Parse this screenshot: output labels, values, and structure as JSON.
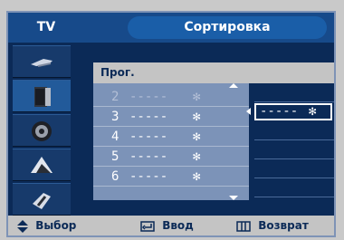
{
  "header": {
    "menu_name": "TV",
    "title": "Сортировка"
  },
  "sidebar": {
    "items": [
      {
        "icon": "antenna-icon"
      },
      {
        "icon": "tv-set-icon"
      },
      {
        "icon": "speaker-icon"
      },
      {
        "icon": "setup-icon"
      },
      {
        "icon": "input-icon"
      }
    ],
    "active_index": 1
  },
  "panel": {
    "header_label": "Прог.",
    "rows": [
      {
        "num": "2",
        "dash": "-----",
        "star": "✻",
        "selected": true
      },
      {
        "num": "3",
        "dash": "-----",
        "star": "✻",
        "selected": false
      },
      {
        "num": "4",
        "dash": "-----",
        "star": "✻",
        "selected": false
      },
      {
        "num": "5",
        "dash": "-----",
        "star": "✻",
        "selected": false
      },
      {
        "num": "6",
        "dash": "-----",
        "star": "✻",
        "selected": false
      }
    ],
    "right_selected": {
      "dash": "-----",
      "star": "✻"
    }
  },
  "footer": {
    "select_label": "Выбор",
    "enter_label": "Ввод",
    "return_label": "Возврат"
  },
  "colors": {
    "background": "#0b2a57",
    "header": "#174a8a",
    "list_bg": "#7c93b8",
    "footer_bg": "#c4c4c4"
  }
}
